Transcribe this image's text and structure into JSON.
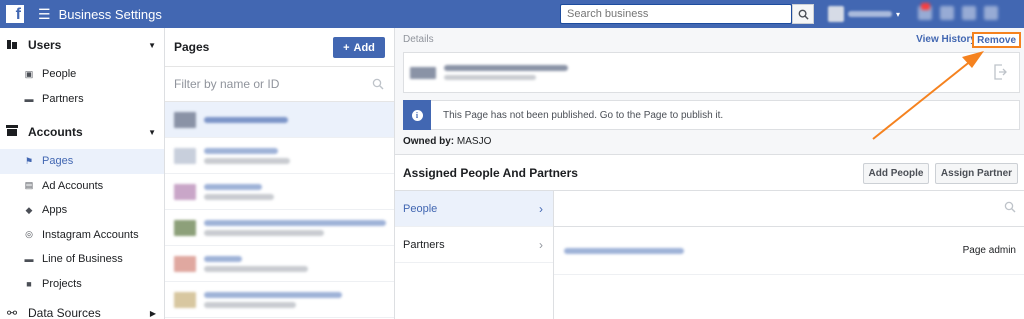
{
  "topbar": {
    "logo_letter": "f",
    "menu_glyph": "☰",
    "title": "Business Settings",
    "search_placeholder": "Search business",
    "search_icon": "search-icon"
  },
  "sidebar": {
    "sections": [
      {
        "label": "Users",
        "icon": "users-icon",
        "items": [
          {
            "label": "People",
            "icon": "person-card-icon"
          },
          {
            "label": "Partners",
            "icon": "briefcase-icon"
          }
        ]
      },
      {
        "label": "Accounts",
        "icon": "accounts-icon",
        "items": [
          {
            "label": "Pages",
            "icon": "flag-icon",
            "active": true
          },
          {
            "label": "Ad Accounts",
            "icon": "ad-account-icon"
          },
          {
            "label": "Apps",
            "icon": "apps-icon"
          },
          {
            "label": "Instagram Accounts",
            "icon": "instagram-icon"
          },
          {
            "label": "Line of Business",
            "icon": "line-of-business-icon"
          },
          {
            "label": "Projects",
            "icon": "folder-icon"
          }
        ]
      },
      {
        "label": "Data Sources",
        "icon": "data-sources-icon",
        "items": []
      }
    ]
  },
  "pages_panel": {
    "title": "Pages",
    "add_label": "Add",
    "add_glyph": "+",
    "filter_placeholder": "Filter by name or ID"
  },
  "details": {
    "header": "Details",
    "view_history": "View History",
    "remove": "Remove",
    "notice_text": "This Page has not been published. Go to the Page to publish it.",
    "owned_by_label": "Owned by:",
    "owned_by_value": "MASJO",
    "assigned_title": "Assigned People And Partners",
    "add_people": "Add People",
    "assign_partner": "Assign Partner",
    "tabs": [
      {
        "label": "People",
        "selected": true
      },
      {
        "label": "Partners",
        "selected": false
      }
    ],
    "role": "Page admin"
  },
  "colors": {
    "brand": "#4267b2",
    "highlight": "#f5821f",
    "selected_bg": "#ebf1fb"
  }
}
